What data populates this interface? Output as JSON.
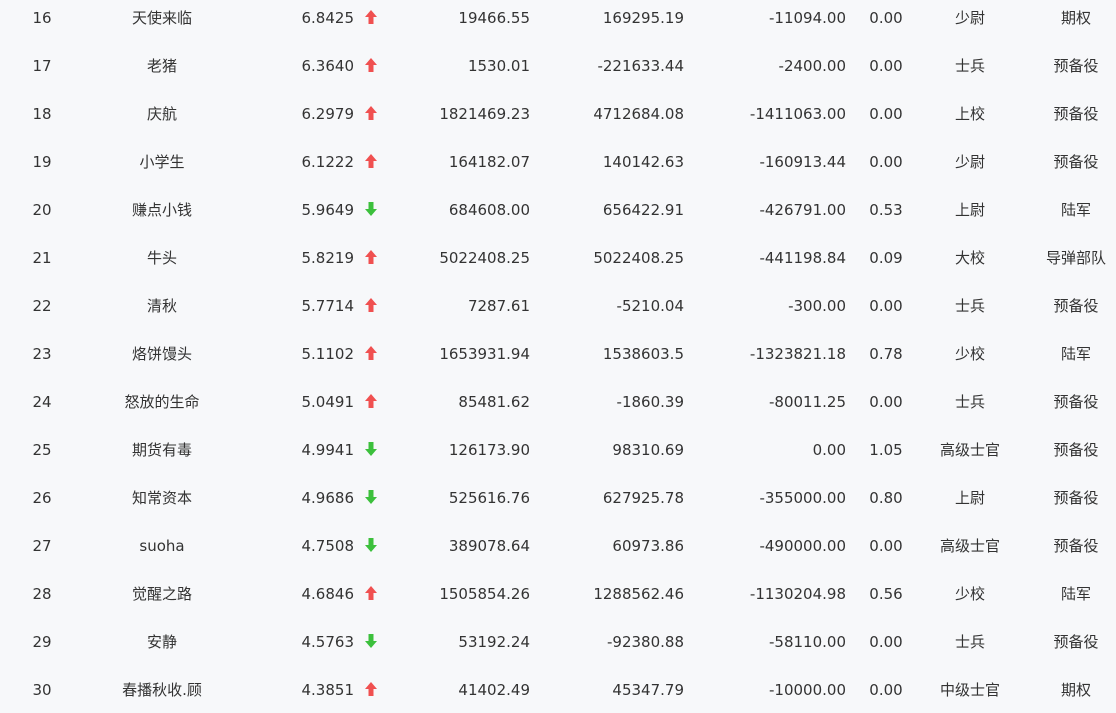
{
  "colors": {
    "up": "#f05050",
    "down": "#3cc03c",
    "text": "#333333",
    "background": "#f7f8fa"
  },
  "rows": [
    {
      "rank": "16",
      "name": "天使来临",
      "score": "6.8425",
      "trend": "up",
      "trend_icon": "arrow-up-icon",
      "v1": "19466.55",
      "v2": "169295.19",
      "v3": "-11094.00",
      "v4": "0.00",
      "rank_title": "少尉",
      "branch": "期权"
    },
    {
      "rank": "17",
      "name": "老猪",
      "score": "6.3640",
      "trend": "up",
      "trend_icon": "arrow-up-icon",
      "v1": "1530.01",
      "v2": "-221633.44",
      "v3": "-2400.00",
      "v4": "0.00",
      "rank_title": "士兵",
      "branch": "预备役"
    },
    {
      "rank": "18",
      "name": "庆航",
      "score": "6.2979",
      "trend": "up",
      "trend_icon": "arrow-up-icon",
      "v1": "1821469.23",
      "v2": "4712684.08",
      "v3": "-1411063.00",
      "v4": "0.00",
      "rank_title": "上校",
      "branch": "预备役"
    },
    {
      "rank": "19",
      "name": "小学生",
      "score": "6.1222",
      "trend": "up",
      "trend_icon": "arrow-up-icon",
      "v1": "164182.07",
      "v2": "140142.63",
      "v3": "-160913.44",
      "v4": "0.00",
      "rank_title": "少尉",
      "branch": "预备役"
    },
    {
      "rank": "20",
      "name": "赚点小钱",
      "score": "5.9649",
      "trend": "down",
      "trend_icon": "arrow-down-icon",
      "v1": "684608.00",
      "v2": "656422.91",
      "v3": "-426791.00",
      "v4": "0.53",
      "rank_title": "上尉",
      "branch": "陆军"
    },
    {
      "rank": "21",
      "name": "牛头",
      "score": "5.8219",
      "trend": "up",
      "trend_icon": "arrow-up-icon",
      "v1": "5022408.25",
      "v2": "5022408.25",
      "v3": "-441198.84",
      "v4": "0.09",
      "rank_title": "大校",
      "branch": "导弹部队"
    },
    {
      "rank": "22",
      "name": "清秋",
      "score": "5.7714",
      "trend": "up",
      "trend_icon": "arrow-up-icon",
      "v1": "7287.61",
      "v2": "-5210.04",
      "v3": "-300.00",
      "v4": "0.00",
      "rank_title": "士兵",
      "branch": "预备役"
    },
    {
      "rank": "23",
      "name": "烙饼馒头",
      "score": "5.1102",
      "trend": "up",
      "trend_icon": "arrow-up-icon",
      "v1": "1653931.94",
      "v2": "1538603.5",
      "v3": "-1323821.18",
      "v4": "0.78",
      "rank_title": "少校",
      "branch": "陆军"
    },
    {
      "rank": "24",
      "name": "怒放的生命",
      "score": "5.0491",
      "trend": "up",
      "trend_icon": "arrow-up-icon",
      "v1": "85481.62",
      "v2": "-1860.39",
      "v3": "-80011.25",
      "v4": "0.00",
      "rank_title": "士兵",
      "branch": "预备役"
    },
    {
      "rank": "25",
      "name": "期货有毒",
      "score": "4.9941",
      "trend": "down",
      "trend_icon": "arrow-down-icon",
      "v1": "126173.90",
      "v2": "98310.69",
      "v3": "0.00",
      "v4": "1.05",
      "rank_title": "高级士官",
      "branch": "预备役"
    },
    {
      "rank": "26",
      "name": "知常资本",
      "score": "4.9686",
      "trend": "down",
      "trend_icon": "arrow-down-icon",
      "v1": "525616.76",
      "v2": "627925.78",
      "v3": "-355000.00",
      "v4": "0.80",
      "rank_title": "上尉",
      "branch": "预备役"
    },
    {
      "rank": "27",
      "name": "suoha",
      "score": "4.7508",
      "trend": "down",
      "trend_icon": "arrow-down-icon",
      "v1": "389078.64",
      "v2": "60973.86",
      "v3": "-490000.00",
      "v4": "0.00",
      "rank_title": "高级士官",
      "branch": "预备役"
    },
    {
      "rank": "28",
      "name": "觉醒之路",
      "score": "4.6846",
      "trend": "up",
      "trend_icon": "arrow-up-icon",
      "v1": "1505854.26",
      "v2": "1288562.46",
      "v3": "-1130204.98",
      "v4": "0.56",
      "rank_title": "少校",
      "branch": "陆军"
    },
    {
      "rank": "29",
      "name": "安静",
      "score": "4.5763",
      "trend": "down",
      "trend_icon": "arrow-down-icon",
      "v1": "53192.24",
      "v2": "-92380.88",
      "v3": "-58110.00",
      "v4": "0.00",
      "rank_title": "士兵",
      "branch": "预备役"
    },
    {
      "rank": "30",
      "name": "春播秋收.顾",
      "score": "4.3851",
      "trend": "up",
      "trend_icon": "arrow-up-icon",
      "v1": "41402.49",
      "v2": "45347.79",
      "v3": "-10000.00",
      "v4": "0.00",
      "rank_title": "中级士官",
      "branch": "期权"
    }
  ]
}
